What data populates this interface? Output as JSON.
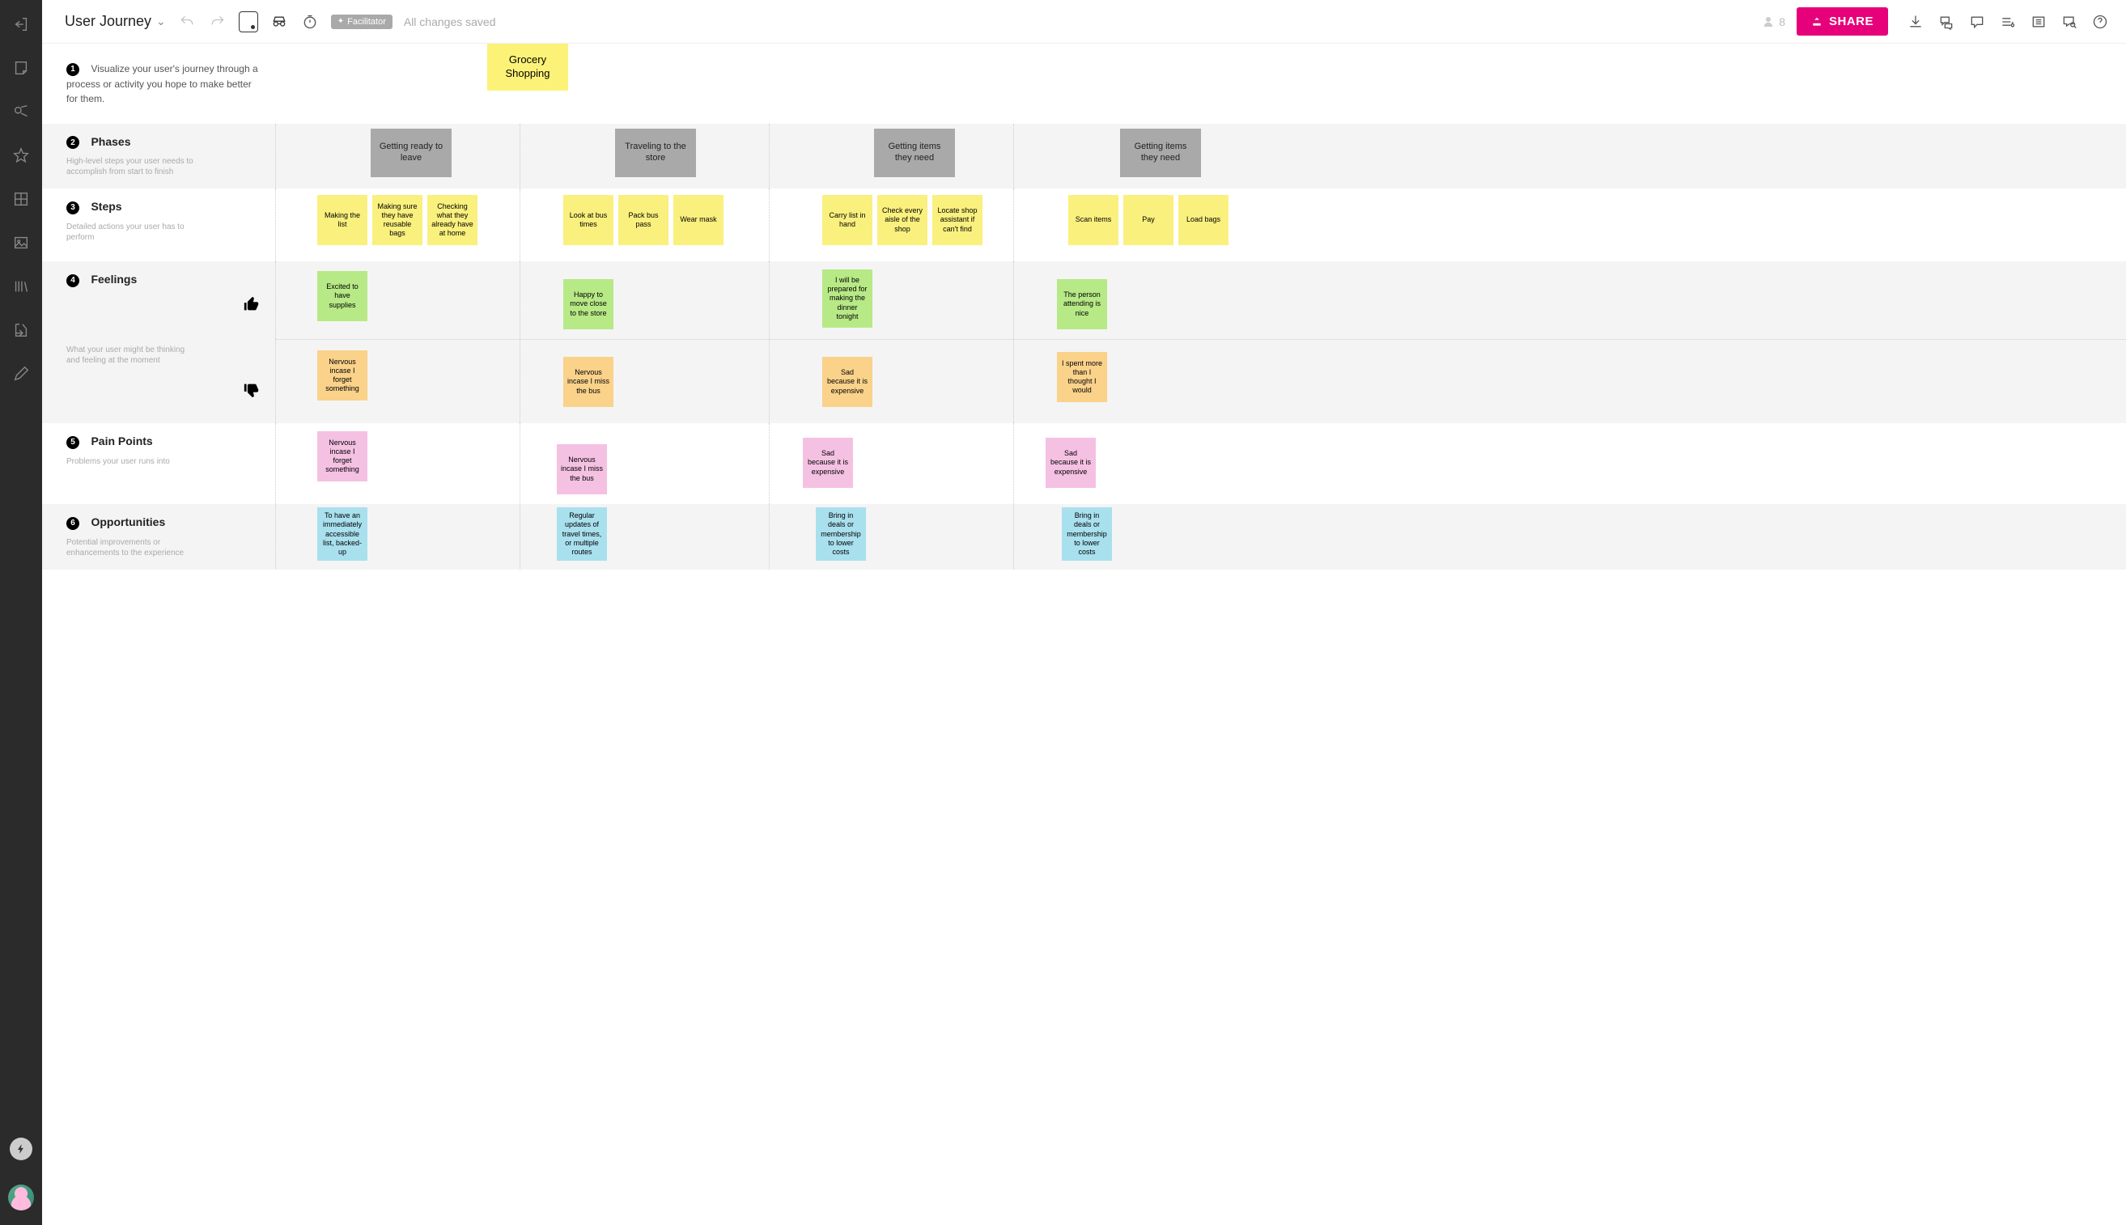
{
  "doc": {
    "title": "User Journey"
  },
  "toolbar": {
    "facilitator": "Facilitator",
    "saved": "All changes saved",
    "participant_count": "8",
    "share": "SHARE"
  },
  "intro": {
    "num": "1",
    "desc": "Visualize your user's journey through a process or activity you hope to make better for them.",
    "title_note": "Grocery Shopping"
  },
  "phases": {
    "num": "2",
    "title": "Phases",
    "desc": "High-level steps your user needs to accomplish from start to finish",
    "items": [
      "Getting ready to leave",
      "Traveling to the store",
      "Getting items they need",
      "Getting items they need"
    ]
  },
  "steps": {
    "num": "3",
    "title": "Steps",
    "desc": "Detailed actions your user has to perform",
    "groups": [
      [
        "Making the list",
        "Making sure they have reusable bags",
        "Checking what they already have at home"
      ],
      [
        "Look at bus times",
        "Pack bus pass",
        "Wear mask"
      ],
      [
        "Carry list in hand",
        "Check every aisle of the shop",
        "Locate shop assistant if can't find"
      ],
      [
        "Scan items",
        "Pay",
        "Load bags"
      ]
    ]
  },
  "feelings": {
    "num": "4",
    "title": "Feelings",
    "desc": "What your user might be thinking and feeling at the moment",
    "positive": [
      "Excited to have supplies",
      "Happy to move close to the store",
      "I will be prepared for making the dinner tonight",
      "The person attending is nice"
    ],
    "negative": [
      "Nervous incase I forget something",
      "Nervous incase I miss the bus",
      "Sad because it is expensive",
      "I spent more than I thought I would"
    ]
  },
  "pain": {
    "num": "5",
    "title": "Pain Points",
    "desc": "Problems your user runs into",
    "items": [
      "Nervous incase I forget something",
      "Nervous incase I miss the bus",
      "Sad because it is expensive",
      "Sad because it is expensive"
    ]
  },
  "opps": {
    "num": "6",
    "title": "Opportunities",
    "desc": "Potential improvements or enhancements to the experience",
    "items": [
      "To have an immediately accessible list, backed-up",
      "Regular updates of travel times, or multiple routes",
      "Bring in deals or membership to lower costs",
      "Bring in deals or membership to lower costs"
    ]
  }
}
